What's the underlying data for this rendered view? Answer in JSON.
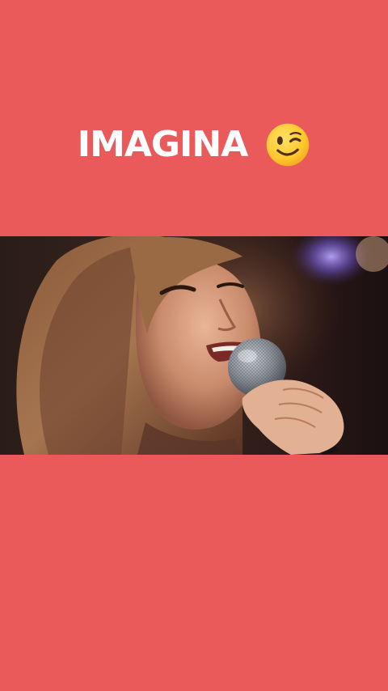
{
  "caption": {
    "text": "IMAGINA",
    "emoji_icon": "winking-face-icon"
  },
  "video": {
    "scene": "singer-with-microphone",
    "microphone_icon": "microphone-icon"
  },
  "colors": {
    "background": "#EA5A5A",
    "caption_text": "#FFFFFF",
    "emoji_face": "#FFCC33"
  }
}
